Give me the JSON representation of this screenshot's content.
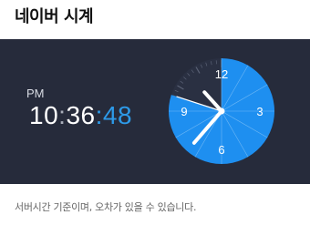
{
  "widget": {
    "title": "네이버 시계",
    "ampm": "PM",
    "hours": "10",
    "minutes": "36",
    "seconds": "48",
    "dial_numbers": {
      "n12": "12",
      "n3": "3",
      "n6": "6",
      "n9": "9"
    },
    "footer_note": "서버시간 기준이며, 오차가 있을 수 있습니다.",
    "colors": {
      "panel_bg": "#262b3b",
      "accent": "#2d9ae8",
      "dial_blue": "#1e8ff0"
    }
  }
}
